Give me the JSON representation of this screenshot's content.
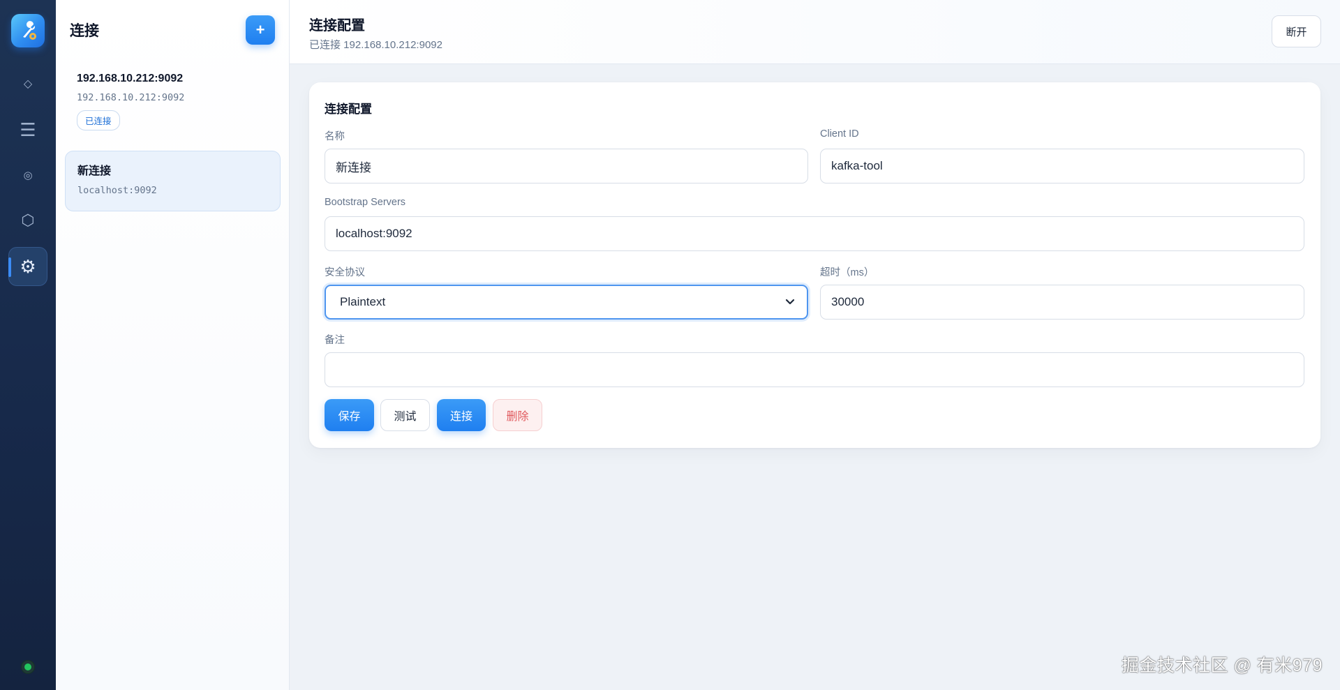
{
  "rail": {
    "items": [
      {
        "icon": "diamond-icon",
        "glyph": "◇"
      },
      {
        "icon": "menu-icon",
        "glyph": "☰"
      },
      {
        "icon": "target-icon",
        "glyph": "◎"
      },
      {
        "icon": "hexagon-icon",
        "glyph": "⬡"
      },
      {
        "icon": "gear-icon",
        "glyph": "⚙"
      }
    ],
    "active_index": 4,
    "status_color": "#22c55e"
  },
  "connections": {
    "title": "连接",
    "add_label": "+",
    "items": [
      {
        "name": "192.168.10.212:9092",
        "address": "192.168.10.212:9092",
        "badge": "已连接"
      },
      {
        "name": "新连接",
        "address": "localhost:9092"
      }
    ]
  },
  "header": {
    "title": "连接配置",
    "subtitle": "已连接 192.168.10.212:9092",
    "disconnect_label": "断开"
  },
  "form": {
    "title": "连接配置",
    "name_label": "名称",
    "name_value": "新连接",
    "client_id_label": "Client ID",
    "client_id_value": "kafka-tool",
    "bootstrap_label": "Bootstrap Servers",
    "bootstrap_value": "localhost:9092",
    "security_label": "安全协议",
    "security_value": "Plaintext",
    "timeout_label": "超时（ms）",
    "timeout_value": "30000",
    "notes_label": "备注",
    "notes_value": ""
  },
  "actions": {
    "save": "保存",
    "test": "测试",
    "connect": "连接",
    "delete": "删除"
  },
  "colors": {
    "accent": "#1f7ff0",
    "danger": "#e15b5f",
    "rail_bg": "#17294a"
  },
  "watermark": "掘金技术社区 @ 有米979"
}
